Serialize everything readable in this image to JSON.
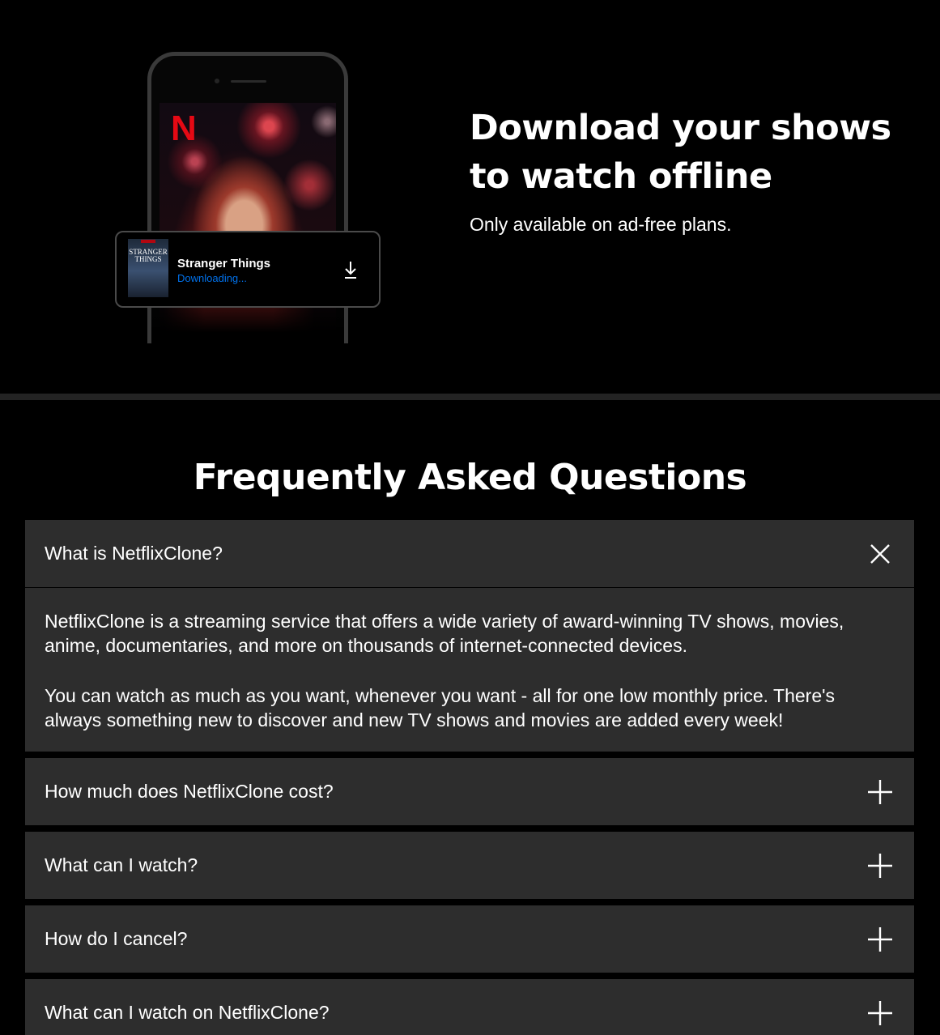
{
  "download": {
    "title_line1": "Download your shows",
    "title_line2": "to watch offline",
    "subtitle": "Only available on ad-free plans.",
    "card": {
      "poster_text": "STRANGER\nTHINGS",
      "title": "Stranger Things",
      "status": "Downloading..."
    }
  },
  "faq": {
    "heading": "Frequently Asked Questions",
    "items": [
      {
        "question": "What is NetflixClone?",
        "expanded": true,
        "answer_p1": "NetflixClone is a streaming service that offers a wide variety of award-winning TV shows, movies, anime, documentaries, and more on thousands of internet-connected devices.",
        "answer_p2": "You can watch as much as you want, whenever you want - all for one low monthly price. There's always something new to discover and new TV shows and movies are added every week!"
      },
      {
        "question": "How much does NetflixClone cost?",
        "expanded": false
      },
      {
        "question": "What can I watch?",
        "expanded": false
      },
      {
        "question": "How do I cancel?",
        "expanded": false
      },
      {
        "question": "What can I watch on NetflixClone?",
        "expanded": false
      }
    ]
  },
  "colors": {
    "background": "#000000",
    "faq_item_bg": "#2d2d2d",
    "divider": "#232323",
    "download_status": "#0071eb",
    "brand_red": "#e50914"
  },
  "icons": {
    "download": "download-arrow-icon",
    "close": "close-x-icon",
    "expand": "plus-icon"
  }
}
